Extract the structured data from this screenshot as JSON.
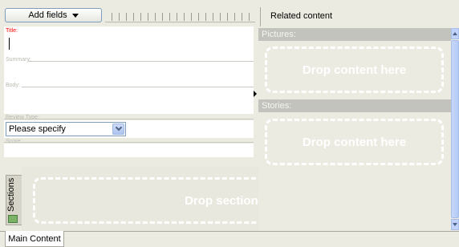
{
  "toolbar": {
    "add_fields_label": "Add fields",
    "related_content_title": "Related content"
  },
  "form": {
    "title_label": "Title:",
    "summary_label": "Summary:",
    "body_label": "Body:",
    "review_type_label": "Review Type:",
    "review_type_value": "Please specify",
    "score_label": "Score:"
  },
  "related": {
    "pictures_header": "Pictures:",
    "pictures_drop": "Drop content here",
    "stories_header": "Stories:",
    "stories_drop": "Drop content here"
  },
  "sections": {
    "tab_label": "Sections",
    "drop_label": "Drop sections here"
  },
  "tabs": {
    "main_content": "Main Content"
  },
  "icons": {
    "add_fields_caret": "caret-down-icon",
    "select_arrow": "chevron-down-icon",
    "panel_toggle": "triangle-right-icon",
    "sections_icon": "sections-icon",
    "scroll_up": "scroll-up-icon",
    "scroll_down": "scroll-down-icon"
  },
  "colors": {
    "background": "#ecebe2",
    "title_label": "#ff0000",
    "section_header": "#c3c3be",
    "drop_zone_border": "#ffffff",
    "scrollbar": "#c1d3fb"
  }
}
